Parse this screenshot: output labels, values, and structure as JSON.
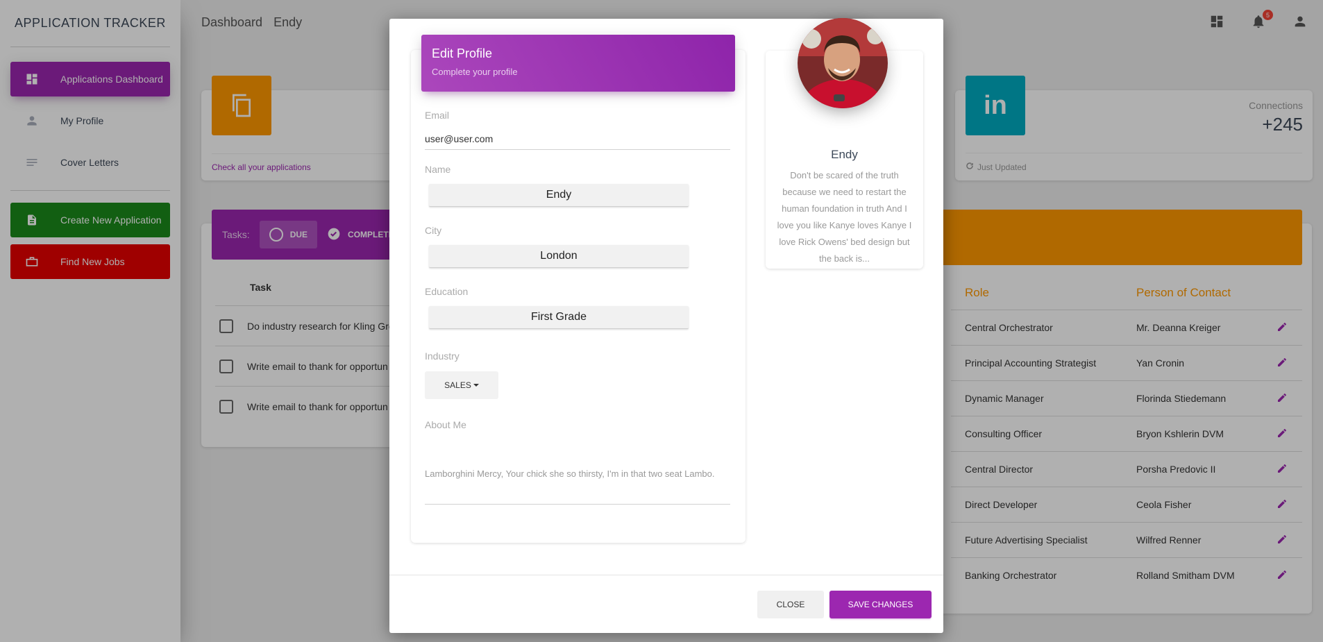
{
  "sidebar": {
    "brand": "APPLICATION TRACKER",
    "items": [
      {
        "label": "Applications Dashboard"
      },
      {
        "label": "My Profile"
      },
      {
        "label": "Cover Letters"
      },
      {
        "label": "Create New Application"
      },
      {
        "label": "Find New Jobs"
      }
    ]
  },
  "topbar": {
    "crumb1": "Dashboard",
    "crumb2": "Endy",
    "notifications_count": "5"
  },
  "stats": {
    "applications_link": "Check all your applications",
    "connections_label": "Connections",
    "connections_value": "+245",
    "updated_label": "Just Updated"
  },
  "tasks": {
    "label": "Tasks:",
    "tab_due": "DUE",
    "tab_completed": "COMPLETE",
    "column_task": "Task",
    "rows": [
      "Do industry research for Kling Gro",
      "Write email to thank for opportun",
      "Write email to thank for opportun"
    ]
  },
  "applications_table": {
    "col_role": "Role",
    "col_contact": "Person of Contact",
    "rows": [
      {
        "role": "Central Orchestrator",
        "contact": "Mr. Deanna Kreiger"
      },
      {
        "role": "Principal Accounting Strategist",
        "contact": "Yan Cronin"
      },
      {
        "role": "Dynamic Manager",
        "contact": "Florinda Stiedemann"
      },
      {
        "role": "Consulting Officer",
        "contact": "Bryon Kshlerin DVM"
      },
      {
        "role": "Central Director",
        "contact": "Porsha Predovic II"
      },
      {
        "role": "Direct Developer",
        "contact": "Ceola Fisher"
      },
      {
        "role": "Future Advertising Specialist",
        "contact": "Wilfred Renner"
      },
      {
        "role": "Banking Orchestrator",
        "contact": "Rolland Smitham DVM"
      }
    ]
  },
  "modal": {
    "title": "Edit Profile",
    "subtitle": "Complete your profile",
    "email_label": "Email",
    "email_value": "user@user.com",
    "name_label": "Name",
    "name_value": "Endy",
    "city_label": "City",
    "city_value": "London",
    "education_label": "Education",
    "education_value": "First Grade",
    "industry_label": "Industry",
    "industry_value": "SALES",
    "about_label": "About Me",
    "about_value": "Lamborghini Mercy, Your chick she so thirsty, I'm in that two seat Lambo.",
    "close_label": "CLOSE",
    "save_label": "SAVE CHANGES",
    "profile_name": "Endy",
    "profile_quote": "Don't be scared of the truth because we need to restart the human foundation in truth And I love you like Kanye loves Kanye I love Rick Owens' bed design but the back is..."
  },
  "colors": {
    "primary": "#9c27b0",
    "orange": "#ff9800",
    "cyan": "#00acc1",
    "green": "#1b8a1b",
    "red": "#e60000"
  }
}
